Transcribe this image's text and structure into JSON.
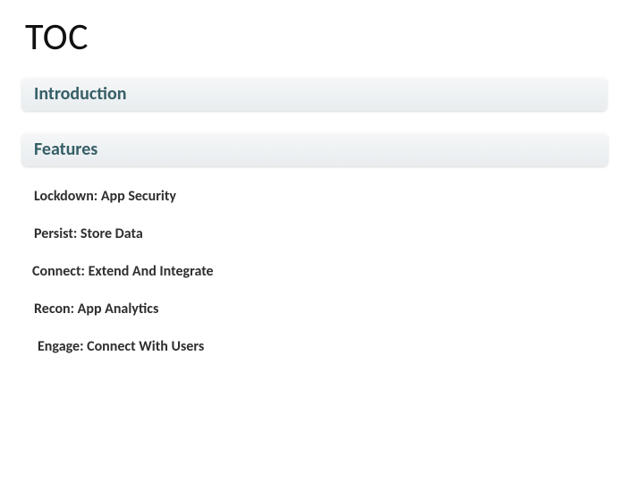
{
  "title": "TOC",
  "sections": {
    "introduction": {
      "label": "Introduction"
    },
    "features": {
      "label": "Features",
      "items": [
        "Lockdown: App Security",
        "Persist: Store Data",
        "Connect: Extend And Integrate",
        "Recon: App Analytics",
        "Engage: Connect With Users"
      ]
    }
  }
}
